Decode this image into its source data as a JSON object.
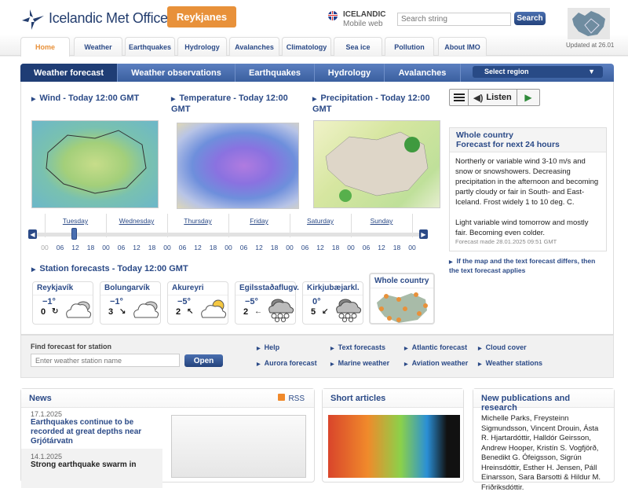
{
  "header": {
    "logo_text": "Icelandic Met Office",
    "region_button": "Reykjanes",
    "lang_title": "ICELANDIC",
    "lang_sub": "Mobile web",
    "search_placeholder": "Search string",
    "search_button": "Search",
    "updated": "Updated at 26.01"
  },
  "nav": [
    "Home",
    "Weather",
    "Earthquakes",
    "Hydrology",
    "Avalanches",
    "Climatology",
    "Sea ice",
    "Pollution",
    "About IMO"
  ],
  "subnav": {
    "tabs": [
      "Weather forecast",
      "Weather observations",
      "Earthquakes",
      "Hydrology",
      "Avalanches"
    ],
    "select_region": "Select region"
  },
  "maps": {
    "wind": "Wind - Today 12:00 GMT",
    "temperature": "Temperature - Today 12:00 GMT",
    "precipitation": "Precipitation - Today 12:00 GMT"
  },
  "listen": {
    "label": "Listen"
  },
  "forecast": {
    "title": "Whole country",
    "subtitle": "Forecast for next 24 hours",
    "p1": "Northerly or variable wind 3-10 m/s and snow or snowshowers. Decreasing precipitation in the afternoon and becoming partly cloudy or fair in South- and East-Iceland. Frost widely 1 to 10 deg. C.",
    "p2": "Light variable wind tomorrow and mostly fair. Becoming even colder.",
    "made": "Forecast made 28.01.2025 09:51 GMT",
    "note": "If the map and the text forecast differs, then the text forecast applies"
  },
  "timeline": {
    "days": [
      "Tuesday",
      "Wednesday",
      "Thursday",
      "Friday",
      "Saturday",
      "Sunday"
    ],
    "hours": [
      "00",
      "06",
      "12",
      "18",
      "00",
      "06",
      "12",
      "18",
      "00",
      "06",
      "12",
      "18",
      "00",
      "06",
      "12",
      "18",
      "00",
      "06",
      "12",
      "18",
      "00",
      "06",
      "12",
      "18",
      "00"
    ],
    "selected": "12"
  },
  "stations": {
    "title": "Station forecasts - Today 12:00 GMT",
    "items": [
      {
        "name": "Reykjavík",
        "temp": "−1°",
        "wind": "0",
        "dir": "↻",
        "icon": "cloudy"
      },
      {
        "name": "Bolungarvík",
        "temp": "−1°",
        "wind": "3",
        "dir": "↘",
        "icon": "cloudy"
      },
      {
        "name": "Akureyri",
        "temp": "−5°",
        "wind": "2",
        "dir": "↖",
        "icon": "partly-cloudy"
      },
      {
        "name": "Egilsstaðaflugv.",
        "temp": "−5°",
        "wind": "2",
        "dir": "←",
        "icon": "snow"
      },
      {
        "name": "Kirkjubæjarkl.",
        "temp": "0°",
        "wind": "5",
        "dir": "↙",
        "icon": "snow"
      }
    ],
    "whole_country": "Whole country"
  },
  "find": {
    "label": "Find forecast for station",
    "placeholder": "Enter weather station name",
    "button": "Open",
    "links": [
      "Help",
      "Text forecasts",
      "Atlantic forecast",
      "Cloud cover",
      "Aurora forecast",
      "Marine weather",
      "Aviation weather",
      "Weather stations"
    ]
  },
  "news": {
    "title": "News",
    "rss": "RSS",
    "items": [
      {
        "date": "17.1.2025",
        "title": "Earthquakes continue to be recorded at great depths near Grjótárvatn"
      },
      {
        "date": "14.1.2025",
        "title": "Strong earthquake swarm in"
      }
    ]
  },
  "short_articles": {
    "title": "Short articles"
  },
  "publications": {
    "title": "New publications and research",
    "text": "Michelle Parks, Freysteinn Sigmundsson, Vincent Drouin, Ásta R. Hjartardóttir, Halldór Geirsson, Andrew Hooper, Kristín S. Vogfjörð, Benedikt G. Ófeigsson, Sigrún Hreinsdóttir, Esther H. Jensen, Páll Einarsson, Sara Barsotti & Hildur M. Friðriksdóttir."
  },
  "colors": {
    "brand_blue": "#2b4a87",
    "accent_orange": "#e8913a"
  }
}
